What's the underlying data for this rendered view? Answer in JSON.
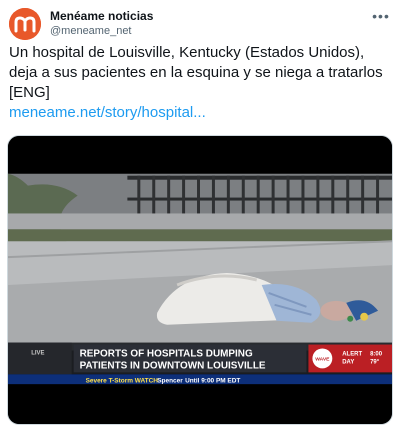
{
  "tweet": {
    "display_name": "Menéame noticias",
    "handle": "@meneame_net",
    "more_icon": "more-horizontal-icon",
    "avatar_letter": "m",
    "avatar_color": "#e8582a",
    "text": "Un hospital de Louisville, Kentucky (Estados Unidos), deja a sus pacientes en la esquina y se niega a tratarlos [ENG]",
    "link": "meneame.net/story/hospital...",
    "link_color": "#1d9bf0"
  },
  "media": {
    "chyron_headline_line1": "REPORTS OF HOSPITALS DUMPING",
    "chyron_headline_line2": "PATIENTS IN DOWNTOWN LOUISVILLE",
    "station_badge": "WAVE",
    "alert_label_line1": "ALERT",
    "alert_label_line2": "DAY",
    "time": "8:00",
    "temperature": "79°",
    "ticker_label": "Severe T-Storm WATCH",
    "ticker_location": "Spencer",
    "ticker_until": "Until 9:00 PM EDT"
  }
}
